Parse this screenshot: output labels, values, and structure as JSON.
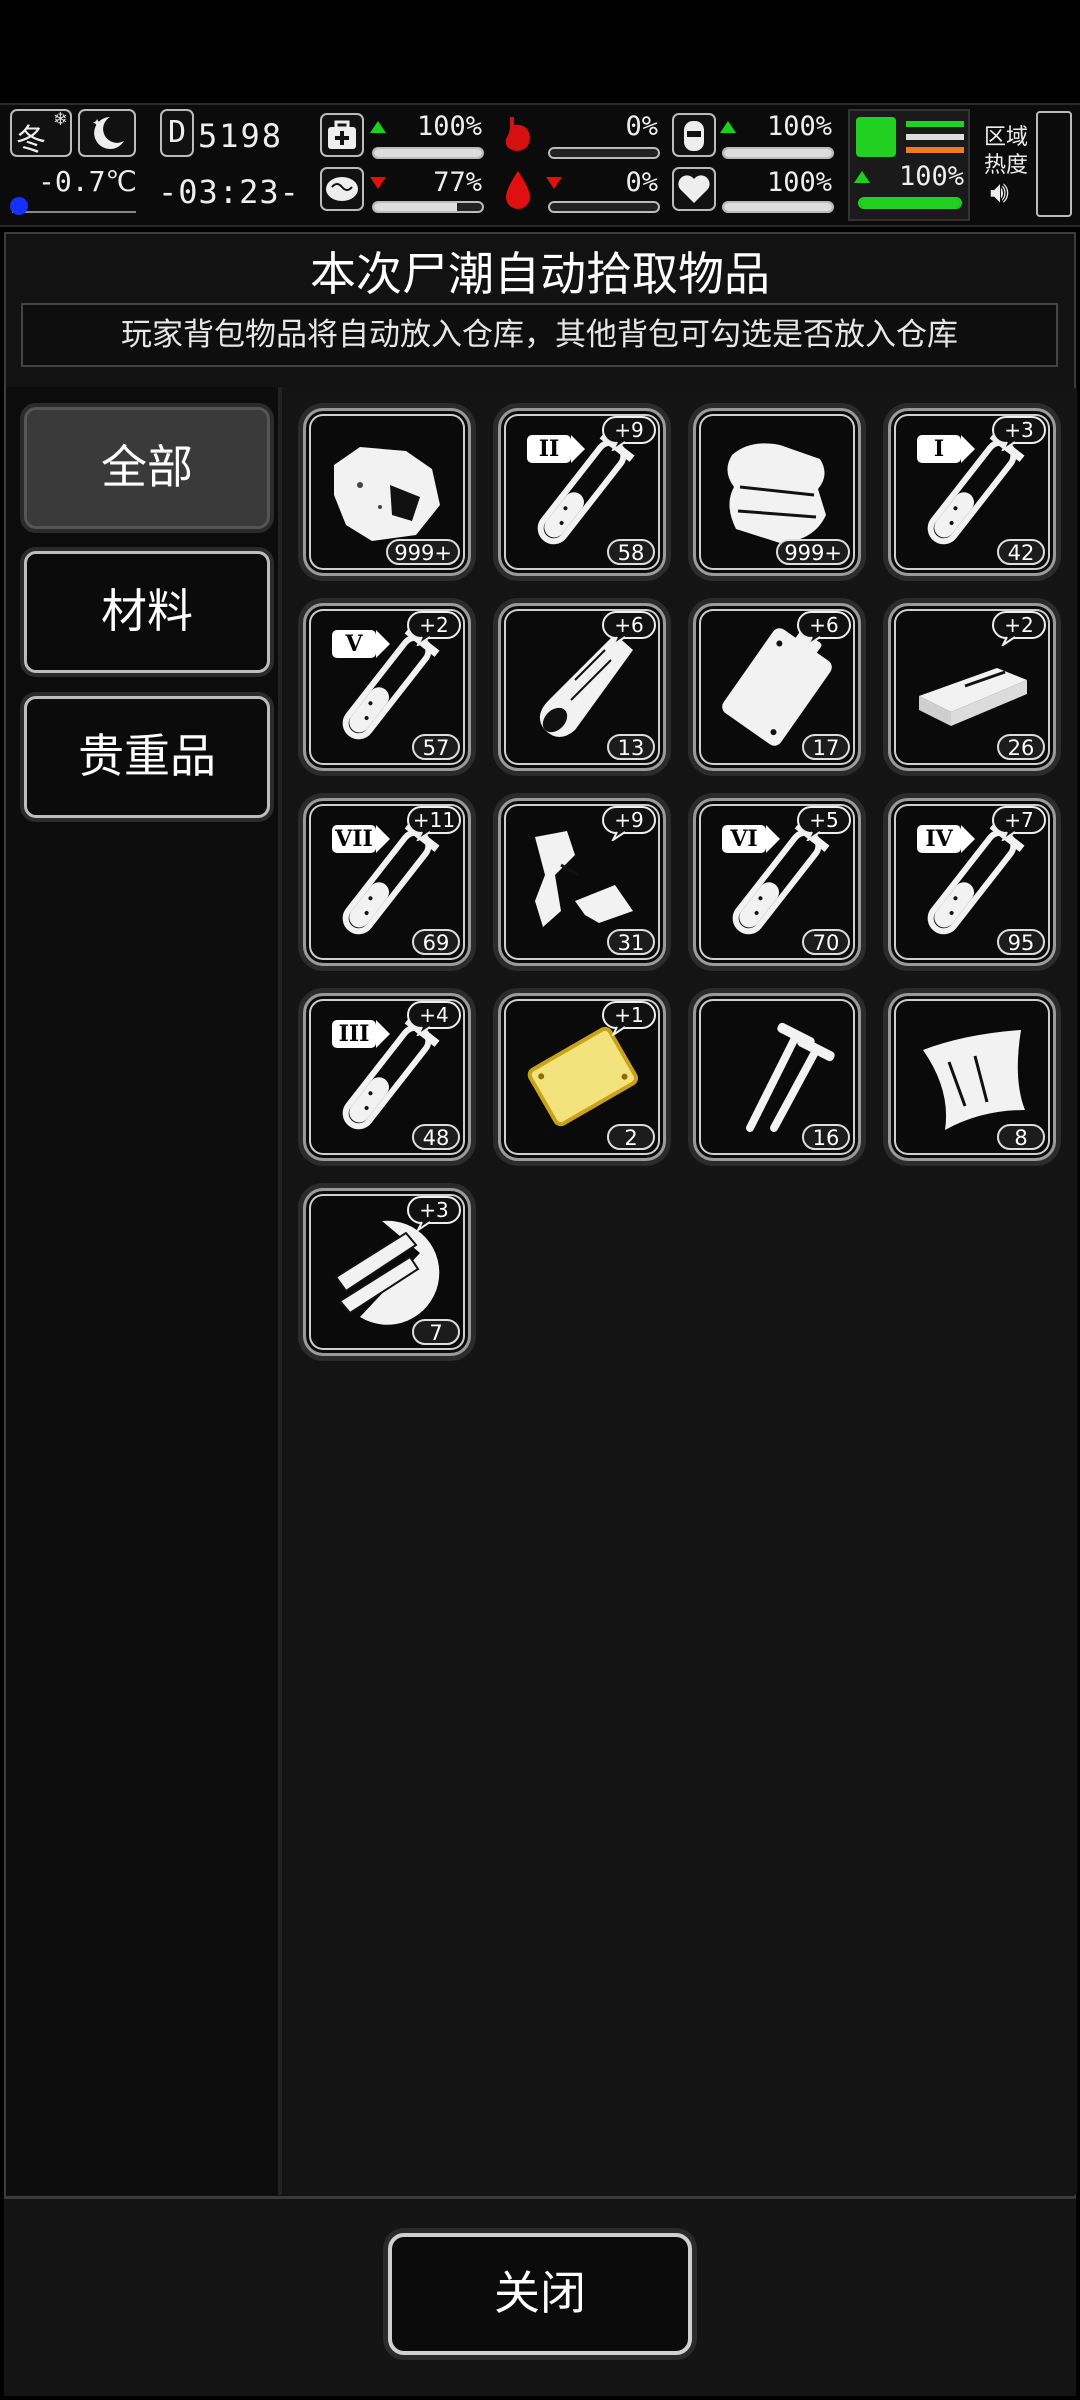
{
  "status": {
    "season": "冬",
    "temperature": "-0.7℃",
    "day_label": "D",
    "day_number": "5198",
    "time": "-03:23-",
    "health_pct": "100%",
    "stomach_pct": "0%",
    "hydration_pct": "100%",
    "brain_pct": "77%",
    "blood_pct": "0%",
    "heart_pct": "100%",
    "stamina_pct": "100%",
    "zone_label_1": "区域",
    "zone_label_2": "热度",
    "levels": {
      "health": 1.0,
      "stomach": 0.0,
      "hydration": 1.0,
      "brain": 0.77,
      "blood": 0.0,
      "heart": 1.0,
      "stamina": 1.0
    }
  },
  "dialog": {
    "title": "本次尸潮自动拾取物品",
    "subtitle": "玩家背包物品将自动放入仓库，其他背包可勾选是否放入仓库",
    "tabs": [
      "全部",
      "材料",
      "贵重品"
    ],
    "close_label": "关闭"
  },
  "items": [
    {
      "icon": "rock-icon",
      "count": "999+",
      "plus": ""
    },
    {
      "icon": "test-tube-icon",
      "roman": "II",
      "count": "58",
      "plus": "+9"
    },
    {
      "icon": "cloth-icon",
      "count": "999+",
      "plus": ""
    },
    {
      "icon": "test-tube-icon",
      "roman": "I",
      "count": "42",
      "plus": "+3"
    },
    {
      "icon": "test-tube-icon",
      "roman": "V",
      "count": "57",
      "plus": "+2"
    },
    {
      "icon": "wood-log-icon",
      "count": "13",
      "plus": "+6"
    },
    {
      "icon": "metal-plate-icon",
      "count": "17",
      "plus": "+6"
    },
    {
      "icon": "wood-plank-icon",
      "count": "26",
      "plus": "+2"
    },
    {
      "icon": "test-tube-icon",
      "roman": "VII",
      "count": "69",
      "plus": "+11"
    },
    {
      "icon": "scrap-metal-icon",
      "count": "31",
      "plus": "+9"
    },
    {
      "icon": "test-tube-icon",
      "roman": "VI",
      "count": "70",
      "plus": "+5"
    },
    {
      "icon": "test-tube-icon",
      "roman": "IV",
      "count": "95",
      "plus": "+7"
    },
    {
      "icon": "test-tube-icon",
      "roman": "III",
      "count": "48",
      "plus": "+4"
    },
    {
      "icon": "gold-plate-icon",
      "count": "2",
      "plus": "+1"
    },
    {
      "icon": "nails-icon",
      "count": "16",
      "plus": ""
    },
    {
      "icon": "glass-pane-icon",
      "count": "8",
      "plus": ""
    },
    {
      "icon": "wood-scraps-icon",
      "count": "7",
      "plus": "+3"
    }
  ]
}
